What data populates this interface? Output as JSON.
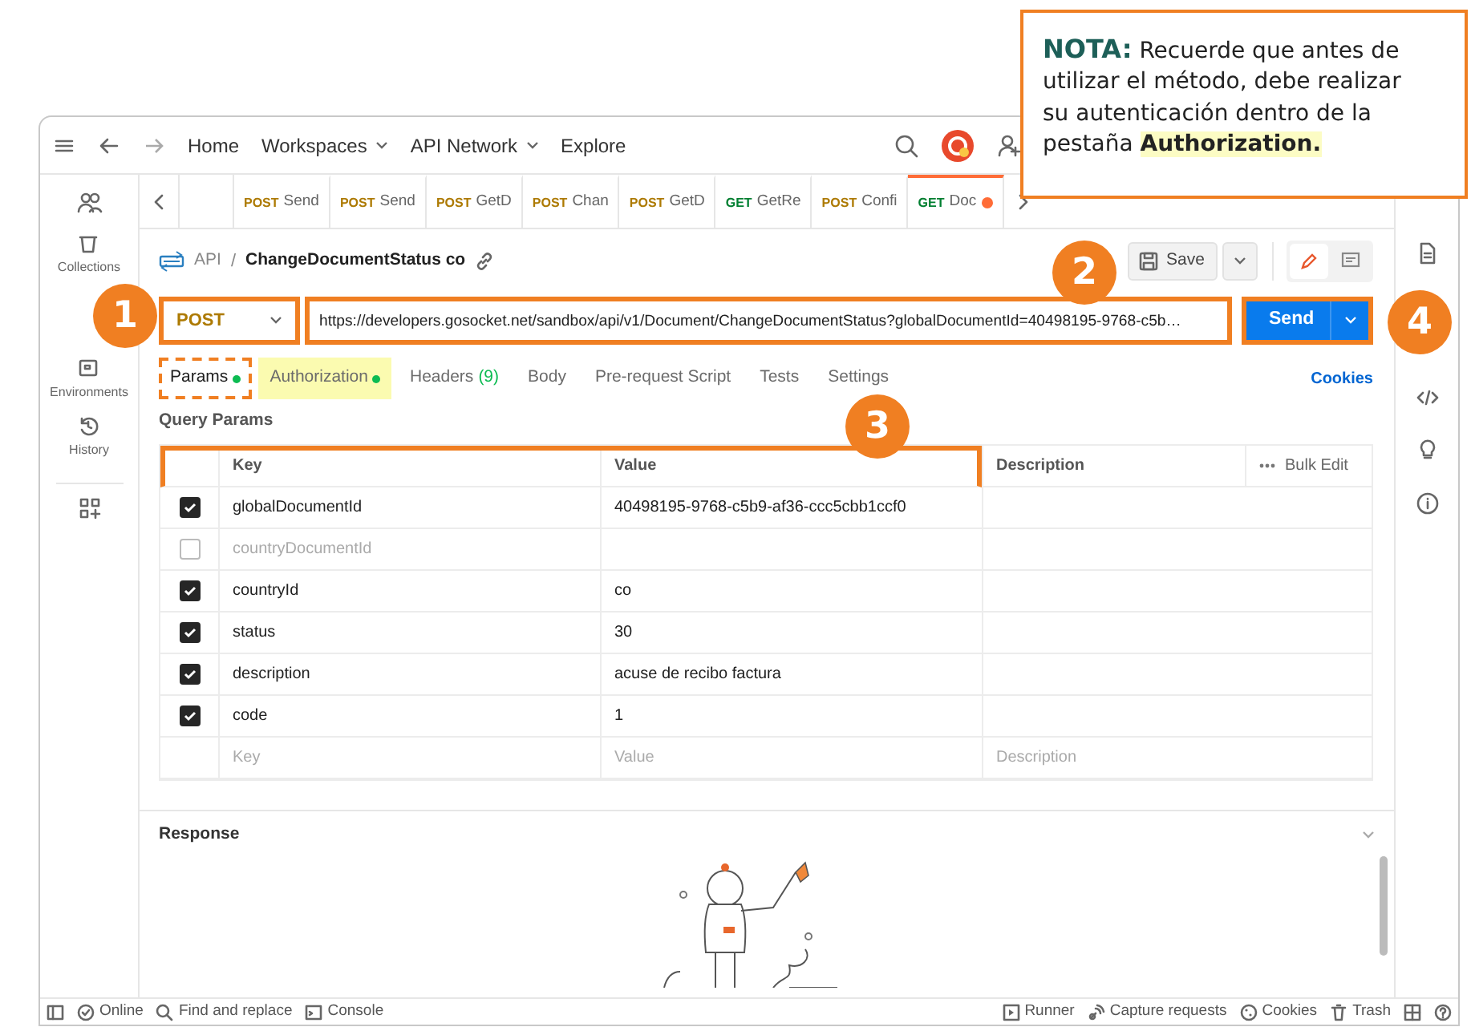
{
  "top_nav": {
    "links": [
      {
        "label": "Home",
        "dropdown": false
      },
      {
        "label": "Workspaces",
        "dropdown": true
      },
      {
        "label": "API Network",
        "dropdown": true
      },
      {
        "label": "Explore",
        "dropdown": false
      }
    ]
  },
  "sidebar": {
    "items": [
      {
        "label": "Collections",
        "kind": "collections"
      },
      {
        "label": "Environments",
        "kind": "environments"
      },
      {
        "label": "History",
        "kind": "history"
      }
    ]
  },
  "open_tabs": [
    {
      "method": "POST",
      "name": "Send",
      "color": "#ad7a03",
      "selected": false,
      "unsaved": false
    },
    {
      "method": "POST",
      "name": "Send",
      "color": "#ad7a03",
      "selected": false,
      "unsaved": false
    },
    {
      "method": "POST",
      "name": "GetD",
      "color": "#ad7a03",
      "selected": false,
      "unsaved": false
    },
    {
      "method": "POST",
      "name": "Chan",
      "color": "#ad7a03",
      "selected": false,
      "unsaved": false
    },
    {
      "method": "POST",
      "name": "GetD",
      "color": "#ad7a03",
      "selected": false,
      "unsaved": false
    },
    {
      "method": "GET",
      "name": "GetRe",
      "color": "#007f31",
      "selected": false,
      "unsaved": false
    },
    {
      "method": "POST",
      "name": "Confi",
      "color": "#ad7a03",
      "selected": false,
      "unsaved": false
    },
    {
      "method": "GET",
      "name": "Doc",
      "color": "#007f31",
      "selected": true,
      "unsaved": true
    }
  ],
  "breadcrumb": {
    "parent": "API",
    "separator": "/",
    "title": "ChangeDocumentStatus co"
  },
  "save_button": {
    "label": "Save"
  },
  "request": {
    "method": {
      "label": "POST",
      "outlined": true
    },
    "url": {
      "value": "https://developers.gosocket.net/sandbox/api/v1/Document/ChangeDocumentStatus?globalDocumentId=40498195-9768-c5b…",
      "outlined": true
    },
    "send": {
      "label": "Send",
      "outlined": true
    }
  },
  "param_tabs": [
    {
      "label": "Params",
      "selected": true,
      "dot": true,
      "outlined": true,
      "highlighted": false
    },
    {
      "label": "Authorization",
      "selected": false,
      "dot": true,
      "outlined": false,
      "highlighted": true
    },
    {
      "label": "Headers",
      "count": "(9)",
      "selected": false,
      "dot": false,
      "outlined": false,
      "highlighted": false
    },
    {
      "label": "Body",
      "selected": false,
      "dot": false,
      "outlined": false,
      "highlighted": false
    },
    {
      "label": "Pre-request Script",
      "selected": false,
      "dot": false,
      "outlined": false,
      "highlighted": false
    },
    {
      "label": "Tests",
      "selected": false,
      "dot": false,
      "outlined": false,
      "highlighted": false
    },
    {
      "label": "Settings",
      "selected": false,
      "dot": false,
      "outlined": false,
      "highlighted": false
    }
  ],
  "cookies_link": "Cookies",
  "query_params": {
    "title": "Query Params",
    "outlined": true,
    "columns": [
      "Key",
      "Value",
      "Description"
    ],
    "bulk_edit": "Bulk Edit",
    "rows": [
      {
        "checked": true,
        "key": "globalDocumentId",
        "value": "40498195-9768-c5b9-af36-ccc5cbb1ccf0"
      },
      {
        "checked": false,
        "key": "countryDocumentId"
      },
      {
        "checked": true,
        "key": "countryId",
        "value": "co"
      },
      {
        "checked": true,
        "key": "status",
        "value": "30"
      },
      {
        "checked": true,
        "key": "description",
        "value": "acuse de recibo factura"
      },
      {
        "checked": true,
        "key": "code",
        "value": "1"
      }
    ],
    "new_row": {
      "key": {
        "placeholder": "Key"
      },
      "value": {
        "placeholder": "Value"
      },
      "description": {
        "placeholder": "Description"
      }
    }
  },
  "response": {
    "title": "Response"
  },
  "status_bar": {
    "left": [
      {
        "label": "Online",
        "kind": "online"
      },
      {
        "label": "Find and replace",
        "kind": "search"
      },
      {
        "label": "Console",
        "kind": "console"
      }
    ],
    "right": [
      {
        "label": "Runner",
        "kind": "runner"
      },
      {
        "label": "Capture requests",
        "kind": "capture"
      },
      {
        "label": "Cookies",
        "kind": "cookies"
      },
      {
        "label": "Trash",
        "kind": "trash"
      }
    ]
  },
  "note": {
    "label": "NOTA:",
    "text": "Recuerde que antes de utilizar el método, debe realizar su autenticación dentro de la pestaña **Authorization.**"
  },
  "callouts": [
    {
      "number": "1"
    },
    {
      "number": "2"
    },
    {
      "number": "3"
    },
    {
      "number": "4"
    }
  ]
}
